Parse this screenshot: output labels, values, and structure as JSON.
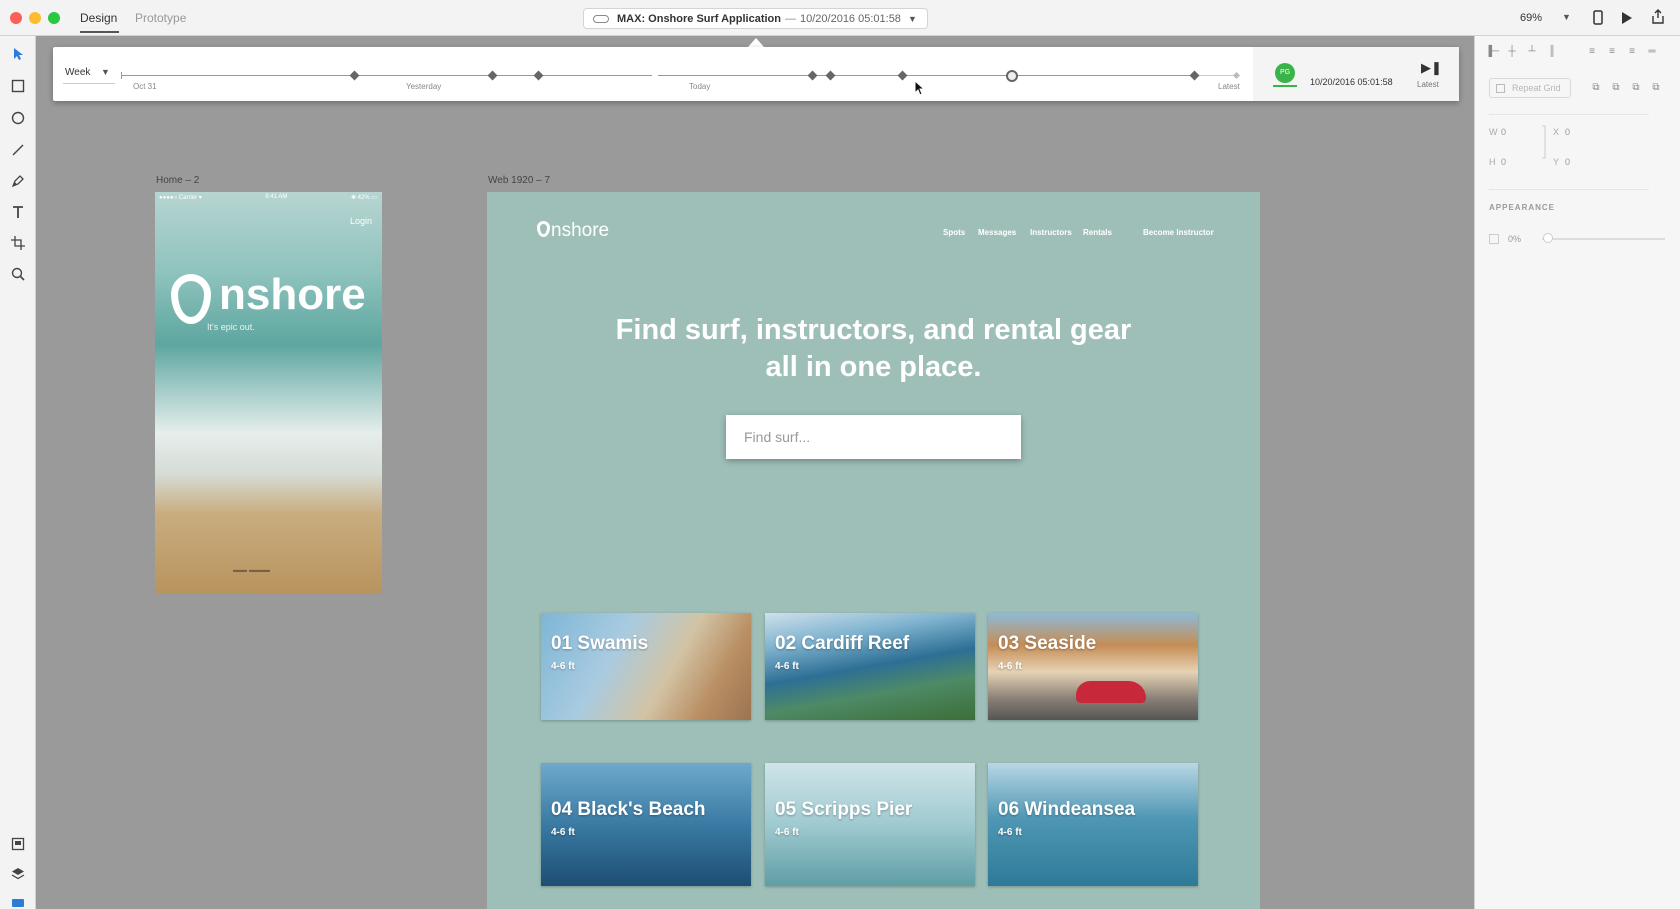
{
  "titlebar": {
    "tabs": [
      {
        "label": "Design",
        "active": true
      },
      {
        "label": "Prototype",
        "active": false
      }
    ],
    "document": {
      "name": "MAX: Onshore Surf Application",
      "separator": "—",
      "timestamp": "10/20/2016 05:01:58"
    },
    "zoom": "69%"
  },
  "history": {
    "range": "Week",
    "labels": [
      "Oct 31",
      "Yesterday",
      "Today",
      "Latest"
    ],
    "user_initials": "PG",
    "current_timestamp": "10/20/2016 05:01:58",
    "latest_label": "Latest"
  },
  "right_panel": {
    "repeat_grid": "Repeat Grid",
    "w": {
      "label": "W",
      "value": "0"
    },
    "h": {
      "label": "H",
      "value": "0"
    },
    "x": {
      "label": "X",
      "value": "0"
    },
    "y": {
      "label": "Y",
      "value": "0"
    },
    "appearance_heading": "APPEARANCE",
    "opacity": "0%",
    "opacity_fraction": 0
  },
  "artboards": {
    "mobile": {
      "label": "Home – 2",
      "status_carrier": "●●●●○ Carrier ▾",
      "status_time": "9:41 AM",
      "status_battery": "✱ 42% ▭",
      "login": "Login",
      "logo": "nshore",
      "tagline": "It's epic out."
    },
    "web": {
      "label": "Web 1920 – 7",
      "logo": "nshore",
      "nav": [
        "Spots",
        "Messages",
        "Instructors",
        "Rentals"
      ],
      "nav_cta": "Become Instructor",
      "headline_line1": "Find surf, instructors, and rental gear",
      "headline_line2": "all in one place.",
      "search_placeholder": "Find surf...",
      "cards": [
        {
          "title": "01 Swamis",
          "height": "4-6 ft"
        },
        {
          "title": "02 Cardiff Reef",
          "height": "4-6 ft"
        },
        {
          "title": "03 Seaside",
          "height": "4-6 ft"
        },
        {
          "title": "04 Black's Beach",
          "height": "4-6 ft"
        },
        {
          "title": "05 Scripps Pier",
          "height": "4-6 ft"
        },
        {
          "title": "06 Windeansea",
          "height": "4-6 ft"
        }
      ]
    }
  },
  "colors": {
    "accent_green": "#3ab44a",
    "canvas": "#9a9a9a",
    "web_background": "#9ebfb8",
    "selection_blue": "#2d7cd6"
  }
}
